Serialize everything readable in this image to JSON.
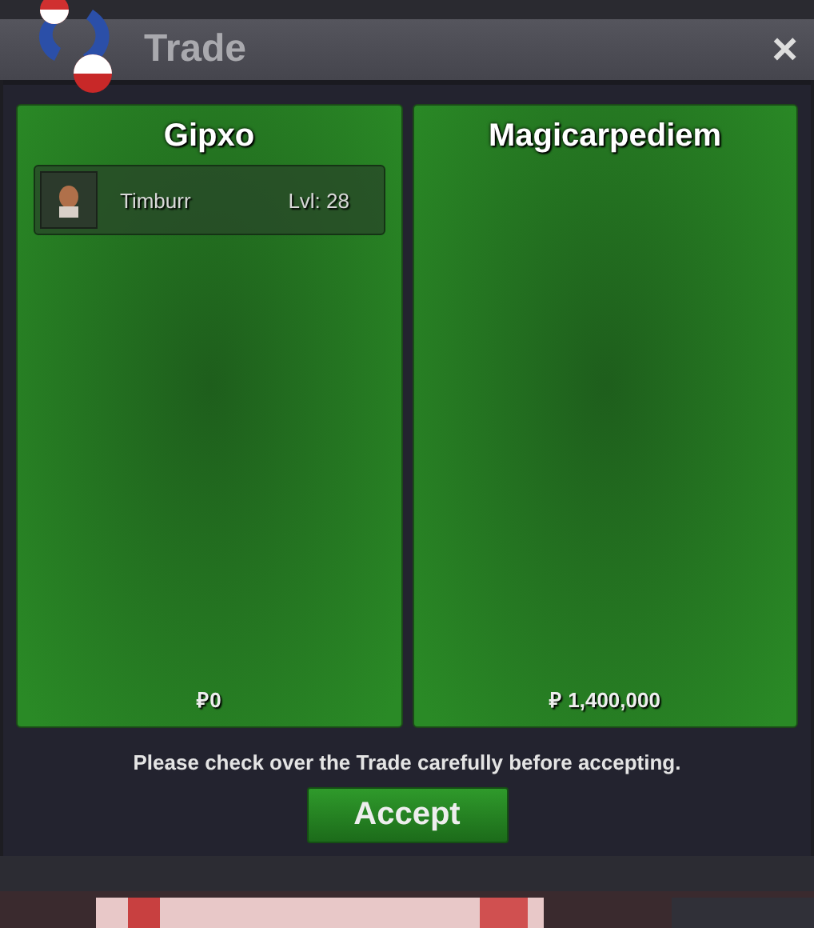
{
  "window": {
    "title": "Trade",
    "close": "×"
  },
  "panels": [
    {
      "player": "Gipxo",
      "items": [
        {
          "name": "Timburr",
          "level": "Lvl: 28"
        }
      ],
      "money": "₽0"
    },
    {
      "player": "Magicarpediem",
      "money": "₽ 1,400,000"
    }
  ],
  "notice": "Please check over the Trade carefully before accepting.",
  "accept_button": "Accept"
}
